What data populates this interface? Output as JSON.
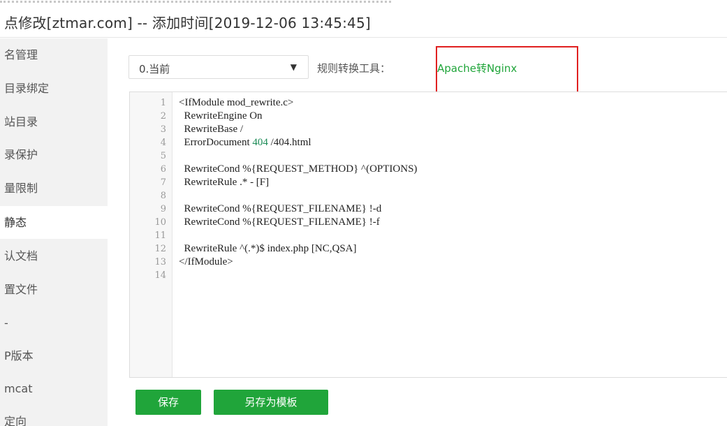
{
  "title": "点修改[ztmar.com] -- 添加时间[2019-12-06 13:45:45]",
  "sidebar": {
    "items": [
      {
        "label": "名管理"
      },
      {
        "label": "目录绑定"
      },
      {
        "label": "站目录"
      },
      {
        "label": "录保护"
      },
      {
        "label": "量限制"
      },
      {
        "label": "静态"
      },
      {
        "label": "认文档"
      },
      {
        "label": "置文件"
      },
      {
        "label": "-"
      },
      {
        "label": "P版本"
      },
      {
        "label": "mcat"
      },
      {
        "label": "定向"
      }
    ]
  },
  "rule_select": {
    "value": "0.当前"
  },
  "tool": {
    "label": "规则转换工具：",
    "link": "Apache转Nginx"
  },
  "code": {
    "lines": [
      "<IfModule mod_rewrite.c>",
      "  RewriteEngine On",
      "  RewriteBase /",
      "  ErrorDocument 404 /404.html",
      "",
      "  RewriteCond %{REQUEST_METHOD} ^(OPTIONS)",
      "  RewriteRule .* - [F]",
      "",
      "  RewriteCond %{REQUEST_FILENAME} !-d",
      "  RewriteCond %{REQUEST_FILENAME} !-f",
      "",
      "  RewriteRule ^(.*)$ index.php [NC,QSA]",
      "</IfModule>",
      ""
    ],
    "line_numbers": [
      "1",
      "2",
      "3",
      "4",
      "5",
      "6",
      "7",
      "8",
      "9",
      "10",
      "11",
      "12",
      "13",
      "14"
    ]
  },
  "buttons": {
    "save": "保存",
    "save_template": "另存为模板"
  },
  "colors": {
    "accent": "#20a53a",
    "highlight_box": "#e02020",
    "code_number": "#1a8a55"
  }
}
